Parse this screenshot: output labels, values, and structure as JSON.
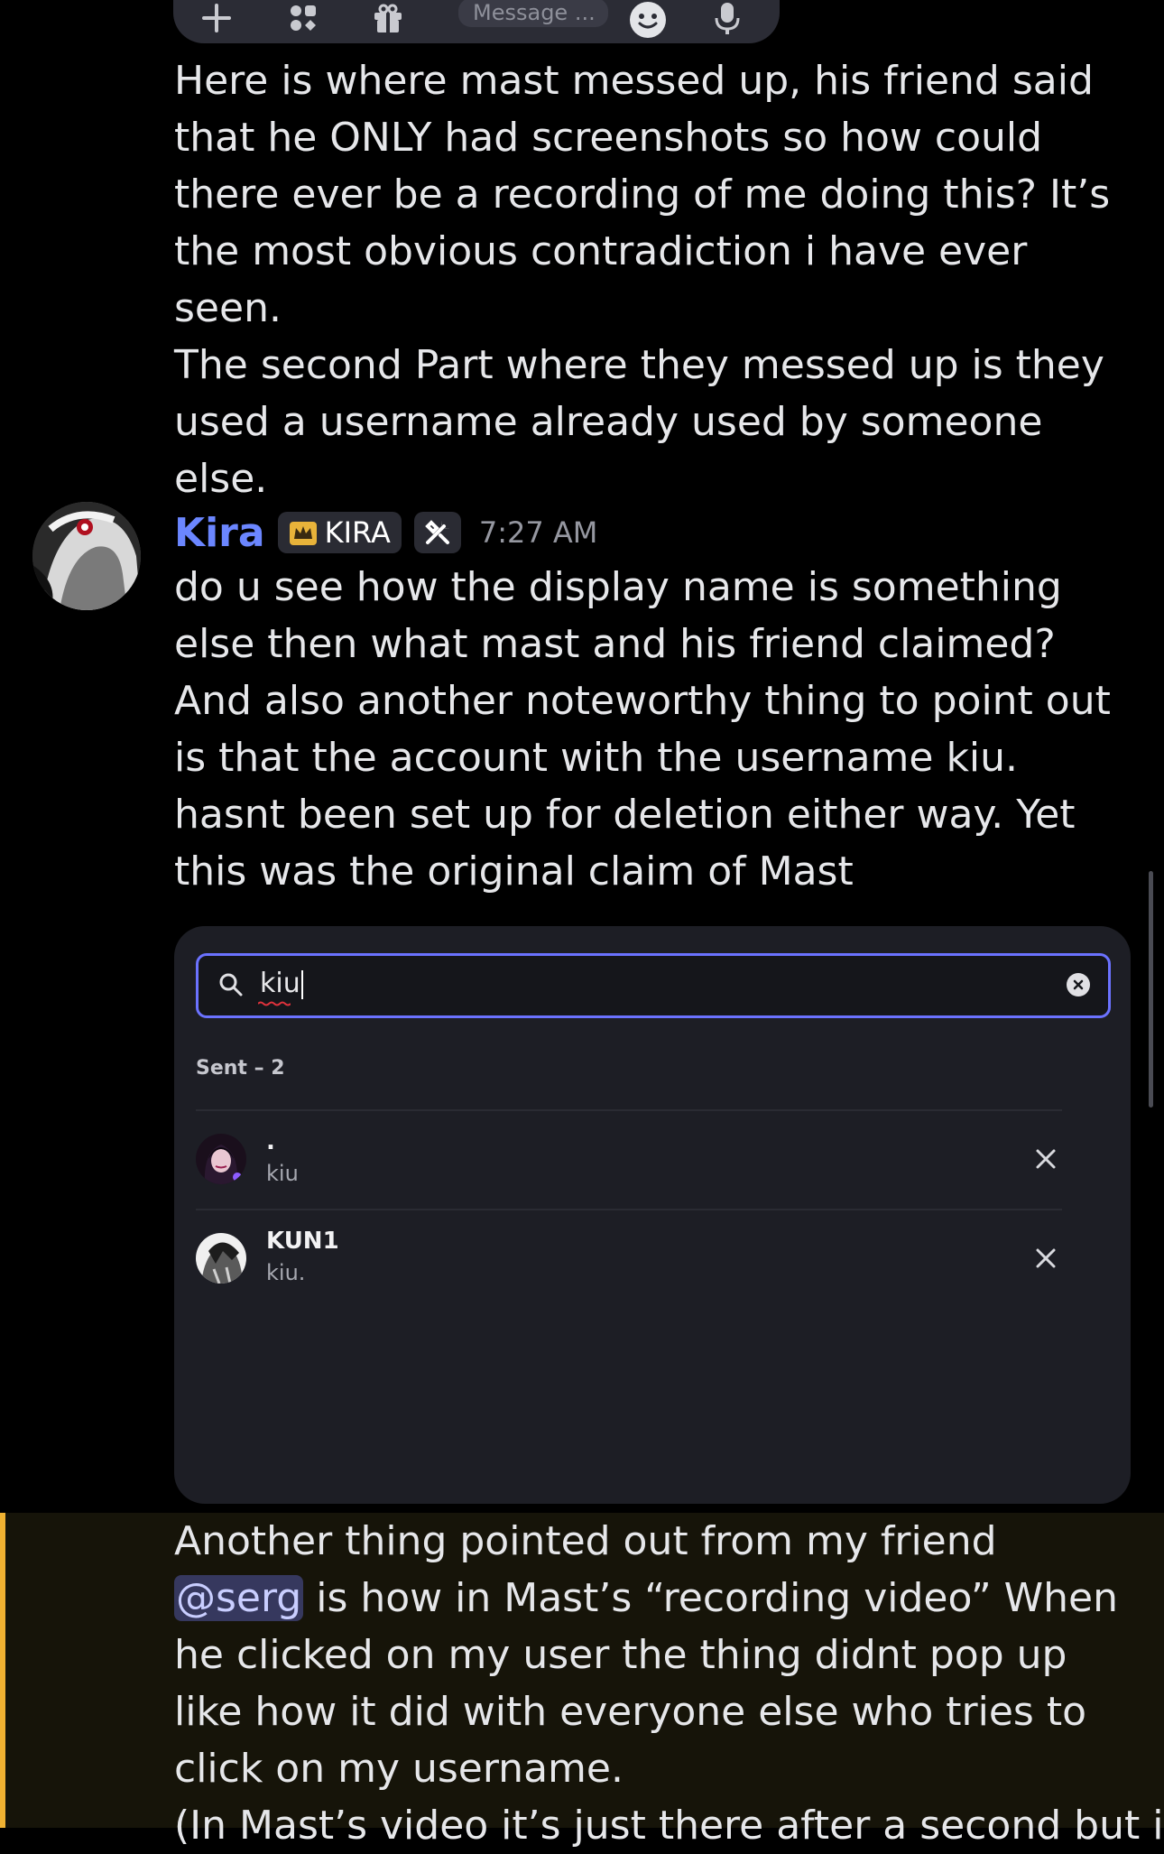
{
  "message_bar": {
    "placeholder": "Message ...",
    "icons": [
      "plus-icon",
      "apps-icon",
      "gift-icon",
      "emoji-icon",
      "microphone-icon"
    ]
  },
  "messages": {
    "first": {
      "paragraph_1": "Here is where mast messed up, his friend said that he ONLY had screenshots so how could there ever be a recording of me doing this? It’s the most obvious contradiction i have ever seen.",
      "paragraph_2": "The second Part where they messed up is they used a username already used by someone else."
    },
    "kira": {
      "username": "Kira",
      "role_tag": "KIRA",
      "timestamp": "7:27 AM",
      "text": "do u see how the display name is something else then what mast and his friend claimed? And also another noteworthy thing to point out is that the account with the username kiu. hasnt been set up for deletion either way. Yet this was the original claim of Mast"
    },
    "highlighted": {
      "text_before": "Another thing pointed out from my friend ",
      "mention": "@serg",
      "text_after": " is how in Mast’s “recording video” When he clicked on my user the thing didnt pop up like how it did with everyone else who tries to click on my username.",
      "partial_line": "(In Mast’s video it’s just there after a second but in"
    }
  },
  "embed": {
    "search_value": "kiu",
    "section_label": "Sent – 2",
    "rows": [
      {
        "display_name": ".",
        "username": "kiu"
      },
      {
        "display_name": "KUN1",
        "username": "kiu."
      }
    ]
  },
  "colors": {
    "username": "#6b86ff",
    "search_border": "#6b72ff",
    "highlight_bar": "#f0b232",
    "mention_bg": "#36385e"
  }
}
